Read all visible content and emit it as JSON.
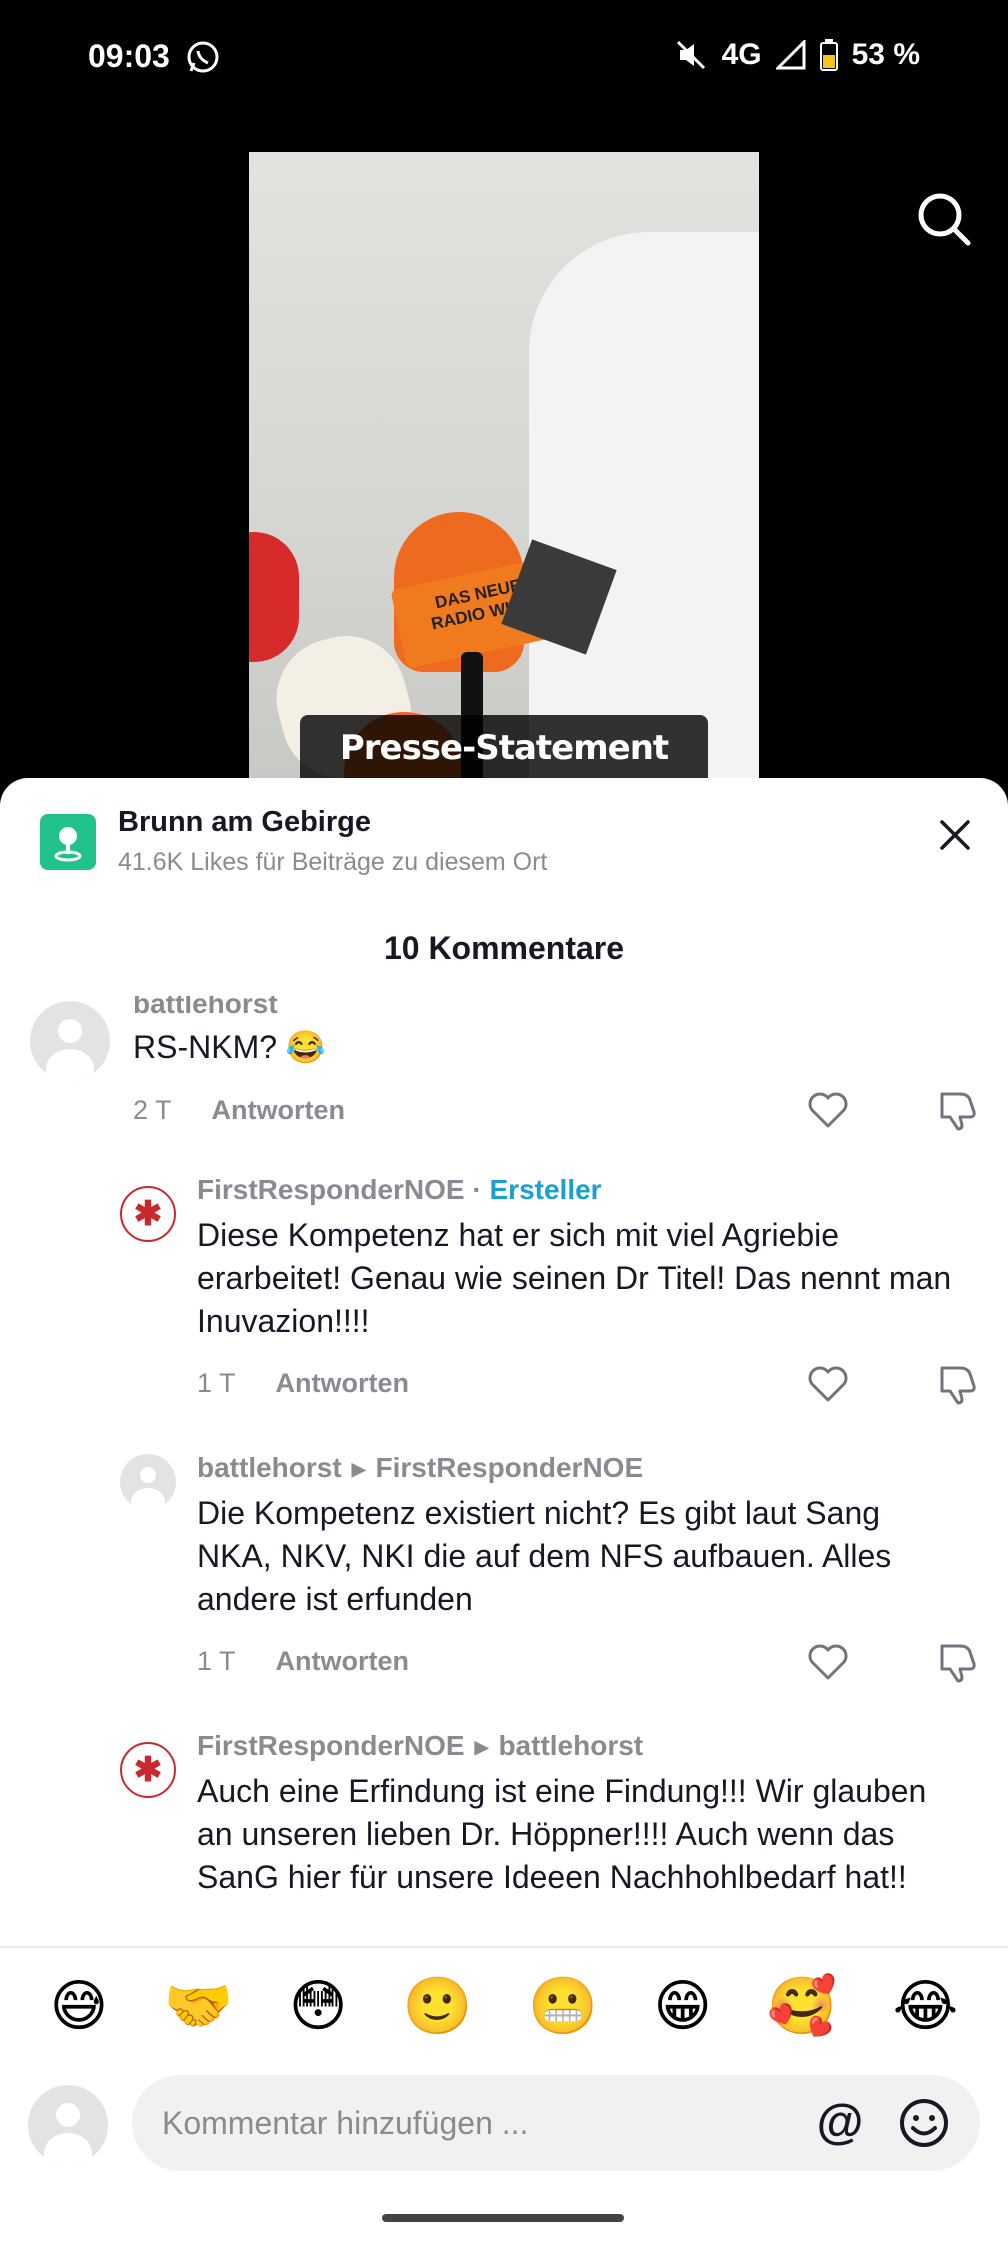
{
  "status_bar": {
    "time": "09:03",
    "network": "4G",
    "battery": "53 %",
    "icons": [
      "whatsapp-icon",
      "mute-icon",
      "signal-icon",
      "battery-icon"
    ]
  },
  "video": {
    "caption": "Presse-Statement anlässlich",
    "mic_label_line1": "DAS NEUE",
    "mic_label_line2": "RADIO WIEN"
  },
  "location": {
    "title": "Brunn am Gebirge",
    "subtitle": "41.6K Likes für Beiträge zu diesem Ort"
  },
  "comments_header": "10 Kommentare",
  "comments": [
    {
      "user": "battlehorst",
      "text": "RS-NKM? 😂",
      "time": "2 T",
      "reply_label": "Antworten"
    },
    {
      "user": "FirstResponderNOE",
      "creator_sep": " · ",
      "creator_badge": "Ersteller",
      "text": "Diese Kompetenz hat er sich mit viel Agriebie erarbeitet! Genau wie seinen Dr Titel! Das nennt man Inuvazion!!!!",
      "time": "1 T",
      "reply_label": "Antworten"
    },
    {
      "user": "battlehorst",
      "reply_to": "FirstResponderNOE",
      "text": "Die Kompetenz existiert nicht? Es gibt laut Sang NKA, NKV, NKI die auf dem NFS aufbauen. Alles andere ist erfunden",
      "time": "1 T",
      "reply_label": "Antworten"
    },
    {
      "user": "FirstResponderNOE",
      "reply_to": "battlehorst",
      "text": "Auch eine Erfindung ist eine Findung!!! Wir glauben an unseren lieben Dr. Höppner!!!! Auch wenn das SanG hier für unsere Ideeen Nachhohlbedarf hat!!"
    }
  ],
  "emoji_bar": [
    "😅",
    "🤝",
    "😳",
    "🙂",
    "😬",
    "😁",
    "🥰",
    "😂"
  ],
  "composer": {
    "placeholder": "Kommentar hinzufügen ...",
    "at_symbol": "@"
  }
}
